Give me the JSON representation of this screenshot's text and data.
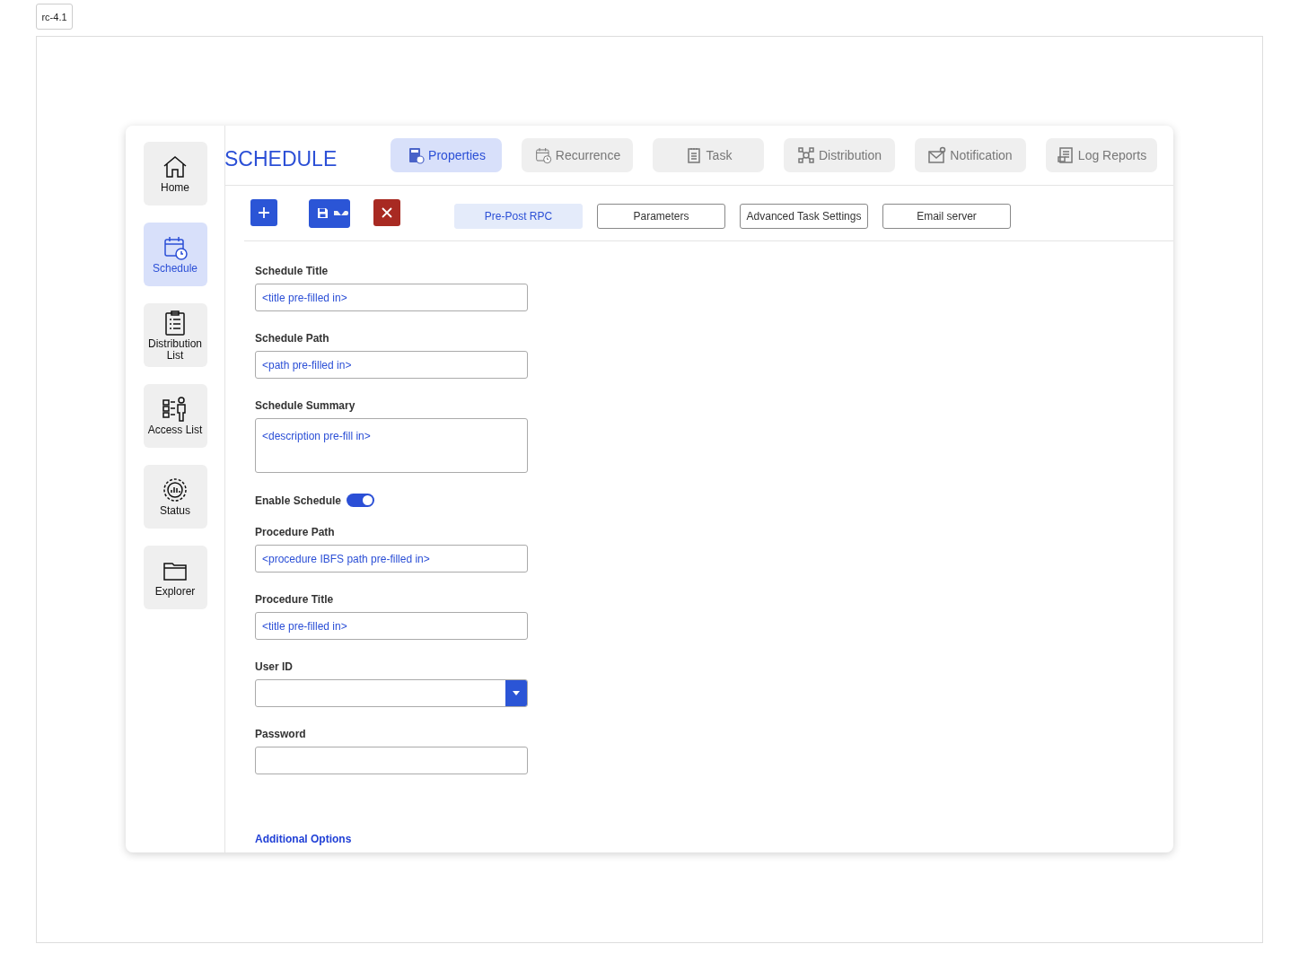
{
  "version_label": "rc-4.1",
  "sidebar": {
    "items": [
      {
        "label": "Home",
        "kind": "home",
        "selected": false
      },
      {
        "label": "Schedule",
        "kind": "calendar",
        "selected": true
      },
      {
        "label": "Distribution List",
        "kind": "clipboard",
        "selected": false
      },
      {
        "label": "Access List",
        "kind": "person",
        "selected": false
      },
      {
        "label": "Status",
        "kind": "gear",
        "selected": false
      },
      {
        "label": "Explorer",
        "kind": "folder",
        "selected": false
      }
    ]
  },
  "title": "SCHEDULE",
  "tabs": [
    {
      "label": "Properties",
      "kind": "doc",
      "selected": true
    },
    {
      "label": "Recurrence",
      "kind": "calendar",
      "selected": false
    },
    {
      "label": "Task",
      "kind": "list",
      "selected": false
    },
    {
      "label": "Distribution",
      "kind": "network",
      "selected": false
    },
    {
      "label": "Notification",
      "kind": "mail",
      "selected": false
    },
    {
      "label": "Log Reports",
      "kind": "report",
      "selected": false
    }
  ],
  "toolbar": {
    "buttons": [
      {
        "kind": "add"
      },
      {
        "kind": "save"
      },
      {
        "kind": "delete"
      }
    ]
  },
  "subtabs": [
    {
      "label": "Pre-Post RPC",
      "selected": true
    },
    {
      "label": "Parameters",
      "selected": false
    },
    {
      "label": "Advanced Task Settings",
      "selected": false
    },
    {
      "label": "Email server",
      "selected": false
    }
  ],
  "form": {
    "fields": [
      {
        "kind": "text",
        "label": "Schedule Title",
        "value": "<title pre-filled in>"
      },
      {
        "kind": "text",
        "label": "Schedule Path",
        "value": "<path pre-filled in>"
      },
      {
        "kind": "textarea",
        "label": "Schedule Summary",
        "value": "<description pre-fill in>"
      },
      {
        "kind": "toggle",
        "label": "Enable Schedule",
        "on": true
      },
      {
        "kind": "text",
        "label": "Procedure Path",
        "value": "<procedure IBFS path pre-filled in>"
      },
      {
        "kind": "text",
        "label": "Procedure Title",
        "value": "<title pre-filled in>"
      },
      {
        "kind": "select",
        "label": "User ID"
      },
      {
        "kind": "password",
        "label": "Password"
      }
    ]
  },
  "additional_options": "Additional Options"
}
